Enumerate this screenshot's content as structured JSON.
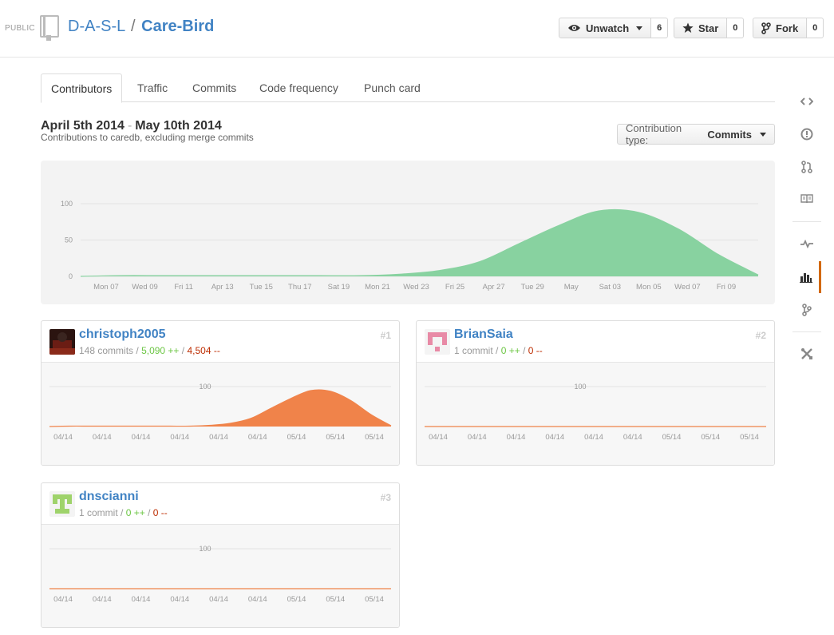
{
  "repo": {
    "visibility": "PUBLIC",
    "owner": "D-A-S-L",
    "separator": "/",
    "name": "Care-Bird"
  },
  "actions": {
    "watch": {
      "label": "Unwatch",
      "count": "6"
    },
    "star": {
      "label": "Star",
      "count": "0"
    },
    "fork": {
      "label": "Fork",
      "count": "0"
    }
  },
  "tabs": [
    {
      "label": "Contributors",
      "selected": true
    },
    {
      "label": "Traffic"
    },
    {
      "label": "Commits"
    },
    {
      "label": "Code frequency"
    },
    {
      "label": "Punch card"
    }
  ],
  "header": {
    "date_start": "April 5th 2014",
    "date_dash": "-",
    "date_end": "May 10th 2014",
    "subtitle": "Contributions to caredb, excluding merge commits",
    "contribution_type_label": "Contribution type:",
    "contribution_type_value": "Commits"
  },
  "colors": {
    "link": "#4183c4",
    "main_area": "#88d2a0",
    "user_area": "#f0834a",
    "selected_nav": "#d26911",
    "additions": "#6cc644",
    "deletions": "#bd2c00"
  },
  "chart_data": [
    {
      "type": "area",
      "ylim": [
        0,
        100
      ],
      "yticks": [
        "100",
        "50",
        "0"
      ],
      "xticks": [
        "Mon 07",
        "Wed 09",
        "Fri 11",
        "Apr 13",
        "Tue 15",
        "Thu 17",
        "Sat 19",
        "Mon 21",
        "Wed 23",
        "Fri 25",
        "Apr 27",
        "Tue 29",
        "May",
        "Sat 03",
        "Mon 05",
        "Wed 07",
        "Fri 09"
      ],
      "series": [
        {
          "values": [
            0,
            1,
            1,
            1,
            1,
            1,
            1,
            1,
            3,
            8,
            20,
            45,
            70,
            90,
            88,
            65,
            30,
            2
          ]
        }
      ]
    },
    {
      "type": "area",
      "ylim": [
        0,
        100
      ],
      "yticks": [
        "100"
      ],
      "xticks": [
        "04/14",
        "04/14",
        "04/14",
        "04/14",
        "04/14",
        "04/14",
        "05/14",
        "05/14",
        "05/14"
      ],
      "series": [
        {
          "values": [
            0,
            1,
            1,
            1,
            1,
            1,
            1,
            1,
            3,
            8,
            20,
            45,
            70,
            90,
            88,
            65,
            30,
            2
          ]
        }
      ]
    },
    {
      "type": "area",
      "ylim": [
        0,
        100
      ],
      "yticks": [
        "100"
      ],
      "xticks": [
        "04/14",
        "04/14",
        "04/14",
        "04/14",
        "04/14",
        "04/14",
        "05/14",
        "05/14",
        "05/14"
      ],
      "series": [
        {
          "values": [
            0,
            0,
            0,
            0,
            0,
            0,
            0,
            0,
            0,
            0,
            0,
            0,
            0,
            0,
            0,
            0,
            0,
            0
          ]
        }
      ]
    },
    {
      "type": "area",
      "ylim": [
        0,
        100
      ],
      "yticks": [
        "100"
      ],
      "xticks": [
        "04/14",
        "04/14",
        "04/14",
        "04/14",
        "04/14",
        "04/14",
        "05/14",
        "05/14",
        "05/14"
      ],
      "series": [
        {
          "values": [
            0,
            0,
            0,
            0,
            0,
            0,
            0,
            0,
            0,
            0,
            0,
            0,
            0,
            0,
            0,
            0,
            0,
            0
          ]
        }
      ]
    }
  ],
  "contributors": [
    {
      "user": "christoph2005",
      "rank": "#1",
      "commits": "148 commits",
      "slash": "/",
      "additions": "5,090 ++",
      "deletions": "4,504 --"
    },
    {
      "user": "BrianSaia",
      "rank": "#2",
      "commits": "1 commit",
      "slash": "/",
      "additions": "0 ++",
      "deletions": "0 --"
    },
    {
      "user": "dnscianni",
      "rank": "#3",
      "commits": "1 commit",
      "slash": "/",
      "additions": "0 ++",
      "deletions": "0 --"
    }
  ],
  "sidebar": [
    {
      "icon": "code-icon"
    },
    {
      "icon": "issues-icon"
    },
    {
      "icon": "pull-request-icon"
    },
    {
      "icon": "wiki-icon"
    },
    {
      "icon": "pulse-icon"
    },
    {
      "icon": "graphs-icon",
      "selected": true
    },
    {
      "icon": "network-icon"
    },
    {
      "icon": "settings-icon"
    }
  ]
}
